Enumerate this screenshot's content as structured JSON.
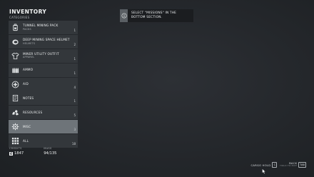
{
  "header": {
    "title": "INVENTORY",
    "subtitle": "CATEGORIES"
  },
  "categories": [
    {
      "name": "TUNNEL MINING PACK",
      "sub": "PACKS",
      "count": "1",
      "icon": "backpack-icon",
      "selected": false
    },
    {
      "name": "DEEP MINING SPACE HELMET",
      "sub": "HELMETS",
      "count": "2",
      "icon": "helmet-icon",
      "selected": false
    },
    {
      "name": "MINER UTILITY OUTFIT",
      "sub": "APPAREL",
      "count": "1",
      "icon": "shirt-icon",
      "selected": false
    },
    {
      "name": "AMMO",
      "sub": "",
      "count": "1",
      "icon": "ammo-icon",
      "selected": false
    },
    {
      "name": "AID",
      "sub": "",
      "count": "4",
      "icon": "aid-icon",
      "selected": false
    },
    {
      "name": "NOTES",
      "sub": "",
      "count": "1",
      "icon": "notes-icon",
      "selected": false
    },
    {
      "name": "RESOURCES",
      "sub": "",
      "count": "5",
      "icon": "resources-icon",
      "selected": false
    },
    {
      "name": "MISC",
      "sub": "",
      "count": "3",
      "icon": "misc-icon",
      "selected": true
    },
    {
      "name": "ALL",
      "sub": "",
      "count": "18",
      "icon": "grid-icon",
      "selected": false
    }
  ],
  "stats": {
    "credits_label": "CREDITS",
    "credits_value": "1847",
    "mass_label": "MASS",
    "mass_value": "94/135"
  },
  "tip": {
    "line1": "SELECT \"MISSIONS\" IN THE",
    "line2": "BOTTOM SECTION."
  },
  "hints": {
    "cargo_label": "CARGO HOLD",
    "cargo_key": "C",
    "back_label": "BACK",
    "back_sub": "HOLD TO EXIT",
    "back_key": "TAB"
  },
  "colors": {
    "background": "#25282c",
    "row": "#33373b",
    "row_selected": "#6e7479",
    "text": "#eef0f1"
  }
}
